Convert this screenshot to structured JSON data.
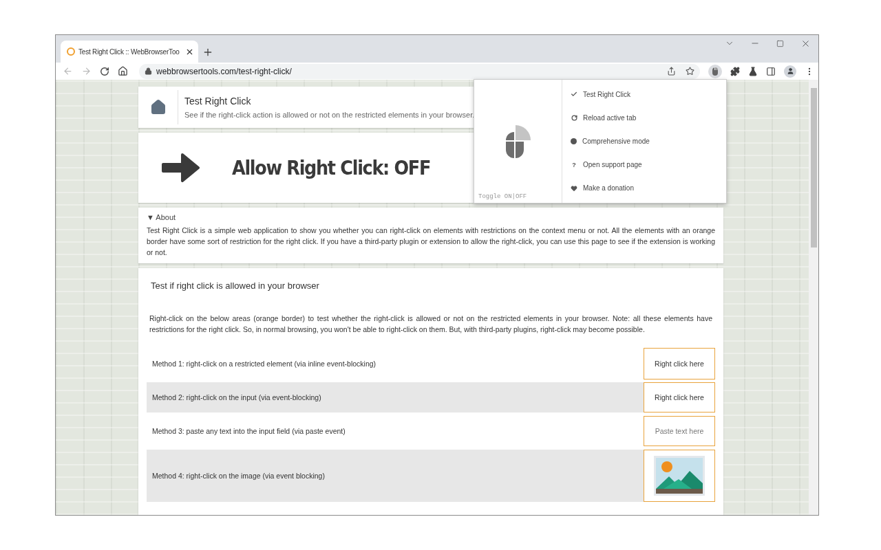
{
  "browser": {
    "tab": {
      "title": "Test Right Click :: WebBrowserToo",
      "selected": true
    },
    "address": "webbrowsertools.com/test-right-click/"
  },
  "header": {
    "title": "Test Right Click",
    "subtitle": "See if the right-click action is allowed or not on the restricted elements in your browser."
  },
  "status_banner": {
    "text": "Allow Right Click: OFF"
  },
  "about": {
    "marker": "▼",
    "summary": "About",
    "text": "Test Right Click is a simple web application to show you whether you can right-click on elements with restrictions on the context menu or not. All the elements with an orange border have some sort of restriction for the right click. If you have a third-party plugin or extension to allow the right-click, you can use this page to see if the extension is working or not."
  },
  "test": {
    "title": "Test if right click is allowed in your browser",
    "intro": "Right-click on the below areas (orange border) to test whether the right-click is allowed or not on the restricted elements in your browser. Note: all these elements have restrictions for the right click. So, in normal browsing, you won't be able to right-click on them. But, with third-party plugins, right-click may become possible.",
    "methods": [
      {
        "kind": "text",
        "label": "Method 1: right-click on a restricted element (via inline event-blocking)",
        "target": "Right click here"
      },
      {
        "kind": "input",
        "label": "Method 2: right-click on the input (via event-blocking)",
        "value": "Right click here"
      },
      {
        "kind": "input",
        "label": "Method 3: paste any text into the input field (via paste event)",
        "placeholder": "Paste text here"
      },
      {
        "kind": "image",
        "label": "Method 4: right-click on the image (via event blocking)"
      }
    ]
  },
  "popup": {
    "toggle": "Toggle ON|OFF",
    "menu": [
      {
        "kind": "check",
        "label": "Test Right Click"
      },
      {
        "kind": "reload",
        "label": "Reload active tab"
      },
      {
        "kind": "dot",
        "label": "Comprehensive mode"
      },
      {
        "kind": "glyph",
        "glyph": "?",
        "label": "Open support page"
      },
      {
        "kind": "heart",
        "label": "Make a donation"
      }
    ]
  }
}
